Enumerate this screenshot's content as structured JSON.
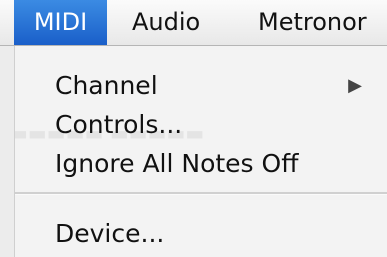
{
  "menubar": {
    "items": [
      {
        "label": "MIDI",
        "active": true
      },
      {
        "label": "Audio",
        "active": false
      },
      {
        "label": "Metronor",
        "active": false
      }
    ]
  },
  "menu": {
    "items": [
      {
        "label": "Channel",
        "submenu_arrow": "▶"
      },
      {
        "label": "Controls..."
      },
      {
        "label": "Ignore All Notes Off"
      },
      {
        "label": "Device..."
      }
    ]
  },
  "colors": {
    "highlight": "#2a73d6",
    "menu_background": "#f3f3f3"
  }
}
